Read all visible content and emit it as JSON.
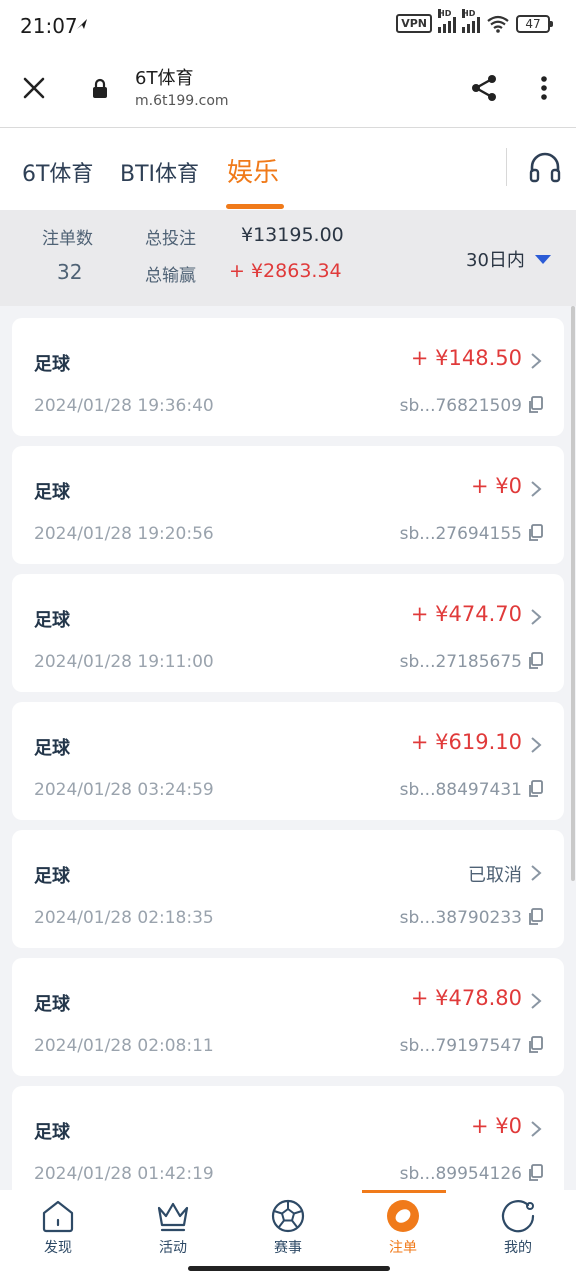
{
  "status_bar": {
    "time": "21:07",
    "vpn": "VPN",
    "hd": "HD",
    "battery": "47"
  },
  "browser": {
    "title": "6T体育",
    "url": "m.6t199.com"
  },
  "tabs": [
    {
      "label": "6T体育"
    },
    {
      "label": "BTI体育"
    },
    {
      "label": "娱乐",
      "active": true
    }
  ],
  "summary": {
    "count_label": "注单数",
    "count_value": "32",
    "total_bet_label": "总投注",
    "total_bet_value": "¥13195.00",
    "total_win_label": "总输赢",
    "total_win_value": "+ ¥2863.34",
    "period": "30日内"
  },
  "bets": [
    {
      "sport": "足球",
      "amount": "+ ¥148.50",
      "date": "2024/01/28 19:36:40",
      "id": "sb...76821509"
    },
    {
      "sport": "足球",
      "amount": "+ ¥0",
      "date": "2024/01/28 19:20:56",
      "id": "sb...27694155"
    },
    {
      "sport": "足球",
      "amount": "+ ¥474.70",
      "date": "2024/01/28 19:11:00",
      "id": "sb...27185675"
    },
    {
      "sport": "足球",
      "amount": "+ ¥619.10",
      "date": "2024/01/28 03:24:59",
      "id": "sb...88497431"
    },
    {
      "sport": "足球",
      "amount": "已取消",
      "date": "2024/01/28 02:18:35",
      "id": "sb...38790233"
    },
    {
      "sport": "足球",
      "amount": "+ ¥478.80",
      "date": "2024/01/28 02:08:11",
      "id": "sb...79197547"
    },
    {
      "sport": "足球",
      "amount": "+ ¥0",
      "date": "2024/01/28 01:42:19",
      "id": "sb...89954126"
    }
  ],
  "bottom_nav": [
    {
      "label": "发现",
      "icon": "home-icon"
    },
    {
      "label": "活动",
      "icon": "crown-icon"
    },
    {
      "label": "赛事",
      "icon": "soccer-ball-icon"
    },
    {
      "label": "注单",
      "icon": "bet-slip-icon",
      "active": true
    },
    {
      "label": "我的",
      "icon": "profile-icon"
    }
  ],
  "colors": {
    "accent": "#f07a1a",
    "win": "#e03a3a",
    "text": "#2b3644",
    "muted": "#9aa3ad"
  }
}
